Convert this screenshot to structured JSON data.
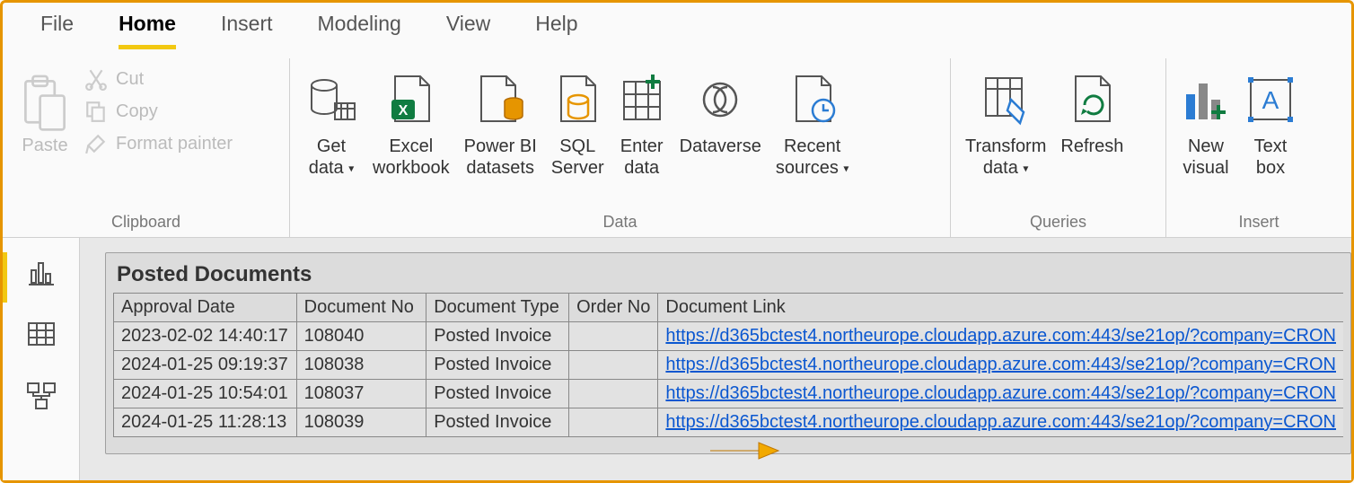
{
  "menu": {
    "tabs": [
      "File",
      "Home",
      "Insert",
      "Modeling",
      "View",
      "Help"
    ],
    "active": "Home"
  },
  "ribbon": {
    "clipboard": {
      "label": "Clipboard",
      "paste": "Paste",
      "cut": "Cut",
      "copy": "Copy",
      "format_painter": "Format painter"
    },
    "data": {
      "label": "Data",
      "get_data": "Get\ndata",
      "excel": "Excel\nworkbook",
      "pbi_datasets": "Power BI\ndatasets",
      "sql_server": "SQL\nServer",
      "enter_data": "Enter\ndata",
      "dataverse": "Dataverse",
      "recent": "Recent\nsources"
    },
    "queries": {
      "label": "Queries",
      "transform": "Transform\ndata",
      "refresh": "Refresh"
    },
    "insert": {
      "label": "Insert",
      "new_visual": "New\nvisual",
      "text_box": "Text\nbox"
    }
  },
  "left_rail": {
    "report_icon": "report-view",
    "table_icon": "data-view",
    "model_icon": "model-view"
  },
  "visual": {
    "title": "Posted Documents",
    "columns": [
      "Approval Date",
      "Document No",
      "Document Type",
      "Order No",
      "Document Link"
    ],
    "rows": [
      {
        "approval_date": "2023-02-02 14:40:17",
        "document_no": "108040",
        "document_type": "Posted Invoice",
        "order_no": "",
        "document_link": "https://d365bctest4.northeurope.cloudapp.azure.com:443/se21op/?company=CRON"
      },
      {
        "approval_date": "2024-01-25 09:19:37",
        "document_no": "108038",
        "document_type": "Posted Invoice",
        "order_no": "",
        "document_link": "https://d365bctest4.northeurope.cloudapp.azure.com:443/se21op/?company=CRON"
      },
      {
        "approval_date": "2024-01-25 10:54:01",
        "document_no": "108037",
        "document_type": "Posted Invoice",
        "order_no": "",
        "document_link": "https://d365bctest4.northeurope.cloudapp.azure.com:443/se21op/?company=CRON"
      },
      {
        "approval_date": "2024-01-25 11:28:13",
        "document_no": "108039",
        "document_type": "Posted Invoice",
        "order_no": "",
        "document_link": "https://d365bctest4.northeurope.cloudapp.azure.com:443/se21op/?company=CRON"
      }
    ]
  }
}
